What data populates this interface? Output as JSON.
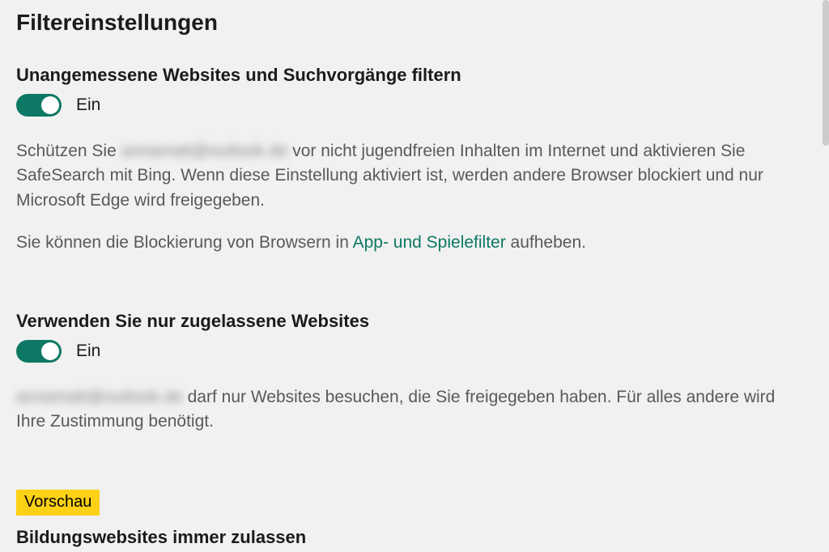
{
  "page": {
    "title": "Filtereinstellungen"
  },
  "section1": {
    "heading": "Unangemessene Websites und Suchvorgänge filtern",
    "toggle_state": "Ein",
    "desc_prefix": "Schützen Sie ",
    "desc_blurred": "annamatt@outlook.de",
    "desc_suffix": " vor nicht jugendfreien Inhalten im Internet und aktivieren Sie SafeSearch mit Bing. Wenn diese Einstellung aktiviert ist, werden andere Browser blockiert und nur Microsoft Edge wird freigegeben.",
    "unblock_prefix": "Sie können die Blockierung von Browsern in ",
    "unblock_link": "App- und Spielefilter",
    "unblock_suffix": " aufheben."
  },
  "section2": {
    "heading": "Verwenden Sie nur zugelassene Websites",
    "toggle_state": "Ein",
    "desc_blurred": "annamatt@outlook.de",
    "desc_suffix": " darf nur Websites besuchen, die Sie freigegeben haben. Für alles andere wird Ihre Zustimmung benötigt."
  },
  "section3": {
    "badge": "Vorschau",
    "heading": "Bildungswebsites immer zulassen"
  }
}
